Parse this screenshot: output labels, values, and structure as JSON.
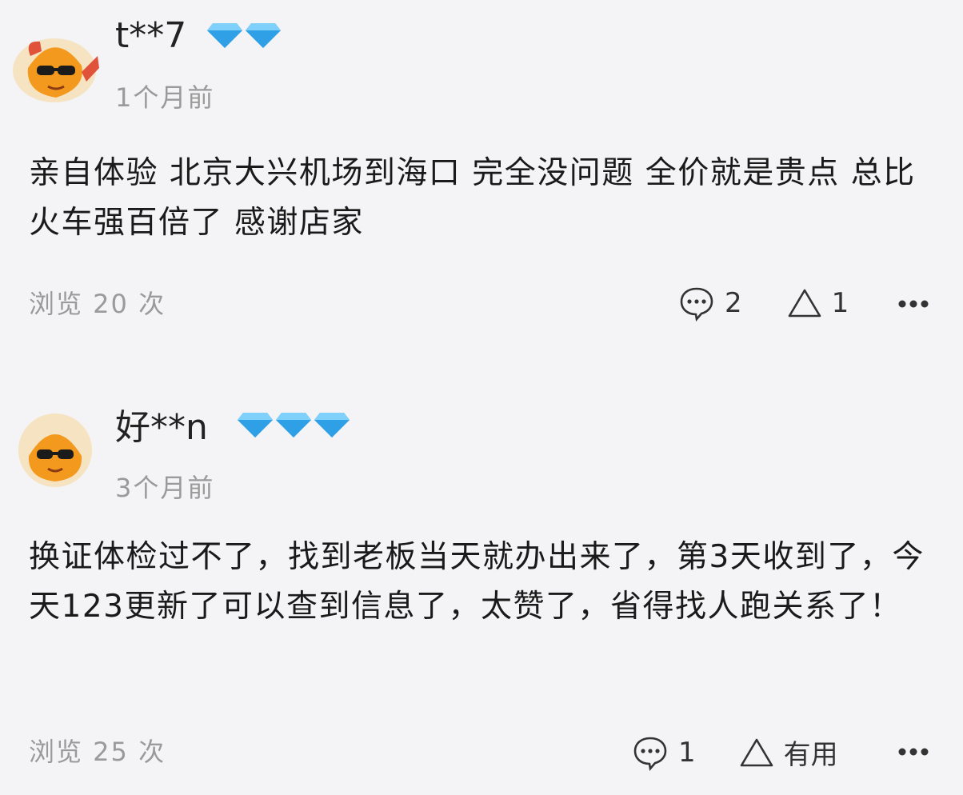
{
  "reviews": [
    {
      "username": "t**7",
      "diamond_count": 2,
      "time": "1个月前",
      "content": "亲自体验  北京大兴机场到海口  完全没问题  全价就是贵点  总比火车强百倍了  感谢店家",
      "views": "浏览 20 次",
      "comment_count": "2",
      "like_label": "1"
    },
    {
      "username": "好**n",
      "diamond_count": 3,
      "time": "3个月前",
      "content": "换证体检过不了，找到老板当天就办出来了，第3天收到了，今天123更新了可以查到信息了，太赞了，省得找人跑关系了！",
      "views": "浏览 25 次",
      "comment_count": "1",
      "like_label": "有用"
    }
  ],
  "icons": {
    "diamond": "diamond-badge-icon",
    "comment": "comment-bubble-icon",
    "like": "triangle-like-icon",
    "more": "more-dots-icon"
  },
  "colors": {
    "background": "#f4f4f6",
    "muted_text": "#9a9a9a",
    "diamond": "#4fb6f3"
  }
}
